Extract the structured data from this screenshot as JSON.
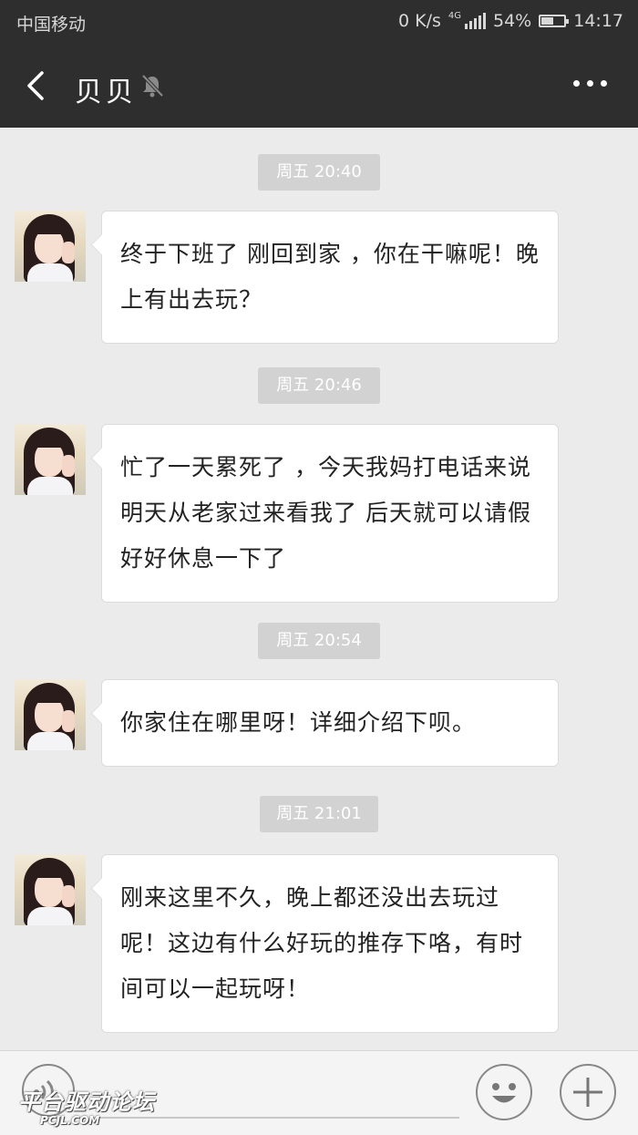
{
  "status_bar": {
    "carrier": "中国移动",
    "speed": "0 K/s",
    "network": "4G",
    "battery": "54%",
    "battery_level": 0.54,
    "time": "14:17"
  },
  "header": {
    "title": "贝贝",
    "back_icon": "chevron-left-icon",
    "mute_icon": "bell-off-icon",
    "more_icon": "more-dots-icon"
  },
  "messages": [
    {
      "timestamp": "周五 20:40",
      "text": "终于下班了 刚回到家 ，你在干嘛呢！晚上有出去玩？"
    },
    {
      "timestamp": "周五 20:46",
      "text": "忙了一天累死了 ，今天我妈打电话来说明天从老家过来看我了 后天就可以请假好好休息一下了"
    },
    {
      "timestamp": "周五 20:54",
      "text": "你家住在哪里呀！详细介绍下呗。"
    },
    {
      "timestamp": "周五 21:01",
      "text": "刚来这里不久，晚上都还没出去玩过呢！这边有什么好玩的推存下咯，有时间可以一起玩呀！"
    }
  ],
  "input_bar": {
    "voice_icon": "voice-icon",
    "emoji_icon": "smiley-icon",
    "plus_icon": "plus-icon"
  },
  "watermark": {
    "main": "平台驱动论坛",
    "sub": "PCJL.COM"
  },
  "colors": {
    "header_bg": "#2e2e2e",
    "chat_bg": "#ebebeb",
    "bubble_bg": "#ffffff",
    "timestamp_bg": "#d2d2d2"
  }
}
